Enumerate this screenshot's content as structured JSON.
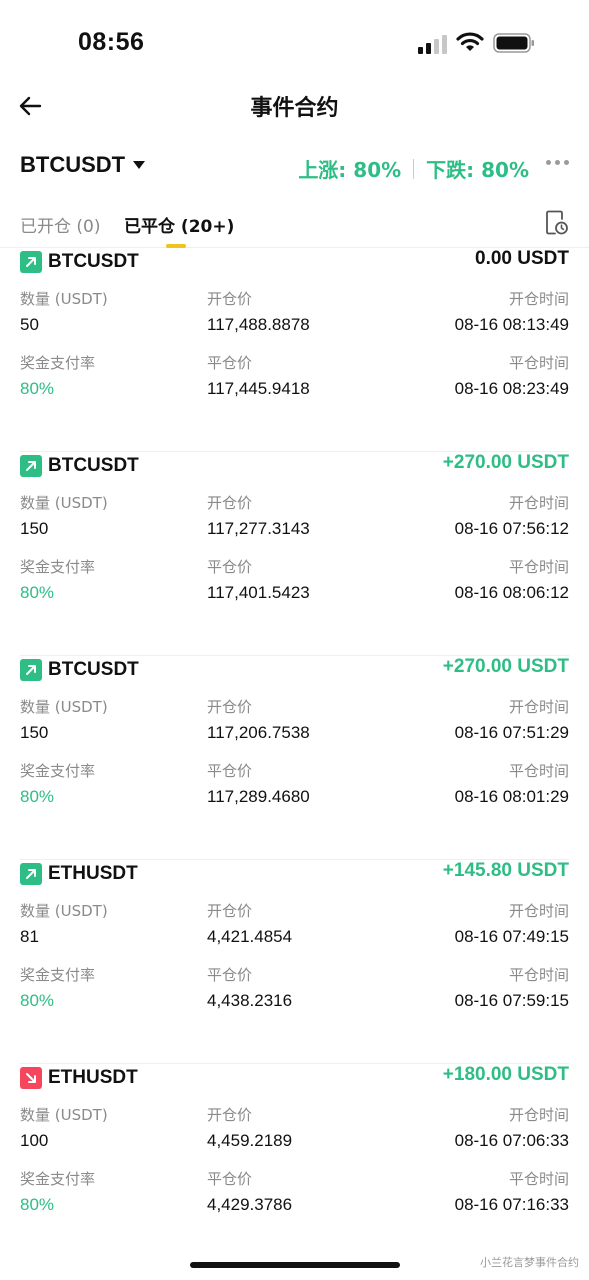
{
  "status_bar": {
    "time": "08:56"
  },
  "nav": {
    "title": "事件合约"
  },
  "symbol_row": {
    "symbol": "BTCUSDT",
    "rate_up": "上涨: 80%",
    "rate_down": "下跌: 80%"
  },
  "tabs": {
    "open": "已开仓 (0)",
    "closed": "已平仓 (20+)"
  },
  "labels": {
    "quantity": "数量 (USDT)",
    "open_price": "开仓价",
    "open_time": "开仓时间",
    "payout_rate": "奖金支付率",
    "close_price": "平仓价",
    "close_time": "平仓时间"
  },
  "trades": [
    {
      "direction": "up",
      "symbol": "BTCUSDT",
      "pnl": "0.00 USDT",
      "quantity": "50",
      "open_price": "117,488.8878",
      "open_time": "08-16 08:13:49",
      "payout_rate": "80%",
      "close_price": "117,445.9418",
      "close_time": "08-16 08:23:49"
    },
    {
      "direction": "up",
      "symbol": "BTCUSDT",
      "pnl": "+270.00 USDT",
      "quantity": "150",
      "open_price": "117,277.3143",
      "open_time": "08-16 07:56:12",
      "payout_rate": "80%",
      "close_price": "117,401.5423",
      "close_time": "08-16 08:06:12"
    },
    {
      "direction": "up",
      "symbol": "BTCUSDT",
      "pnl": "+270.00 USDT",
      "quantity": "150",
      "open_price": "117,206.7538",
      "open_time": "08-16 07:51:29",
      "payout_rate": "80%",
      "close_price": "117,289.4680",
      "close_time": "08-16 08:01:29"
    },
    {
      "direction": "up",
      "symbol": "ETHUSDT",
      "pnl": "+145.80 USDT",
      "quantity": "81",
      "open_price": "4,421.4854",
      "open_time": "08-16 07:49:15",
      "payout_rate": "80%",
      "close_price": "4,438.2316",
      "close_time": "08-16 07:59:15"
    },
    {
      "direction": "down",
      "symbol": "ETHUSDT",
      "pnl": "+180.00 USDT",
      "quantity": "100",
      "open_price": "4,459.2189",
      "open_time": "08-16 07:06:33",
      "payout_rate": "80%",
      "close_price": "4,429.3786",
      "close_time": "08-16 07:16:33"
    }
  ],
  "watermark": "小兰花言梦事件合约",
  "colors": {
    "up": "#2ebd85",
    "down": "#f6465d",
    "tab_indicator": "#f0c419"
  }
}
